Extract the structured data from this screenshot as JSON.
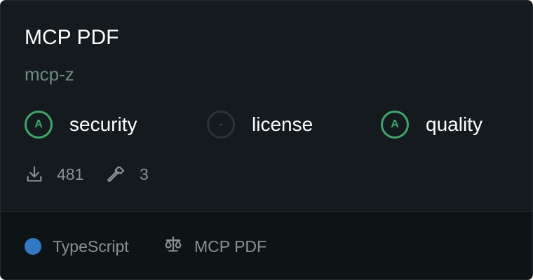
{
  "card": {
    "title": "MCP PDF",
    "author": "mcp-z"
  },
  "scores": [
    {
      "grade": "A",
      "label": "security",
      "status": "pass"
    },
    {
      "grade": "-",
      "label": "license",
      "status": "none"
    },
    {
      "grade": "A",
      "label": "quality",
      "status": "pass"
    }
  ],
  "stats": {
    "downloads": "481",
    "tools": "3"
  },
  "footer": {
    "language": "TypeScript",
    "language_color": "#3178c6",
    "license": "MCP PDF"
  },
  "icons": {
    "downloads": "download-icon",
    "tools": "hammer-icon",
    "license": "scale-icon"
  },
  "colors": {
    "grade_pass": "#3fa76b",
    "author": "#6e8b81",
    "background": "#141a1e"
  }
}
